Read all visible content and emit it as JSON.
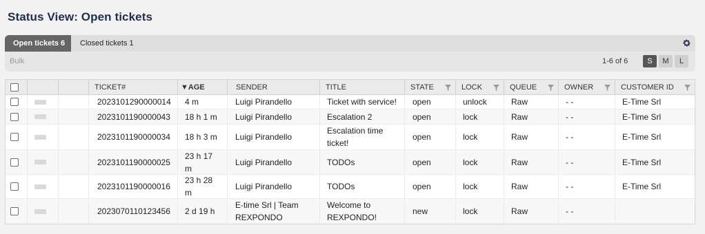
{
  "page": {
    "title": "Status View: Open tickets"
  },
  "tabs": [
    {
      "label": "Open tickets",
      "count": "6",
      "active": true
    },
    {
      "label": "Closed tickets",
      "count": "1",
      "active": false
    }
  ],
  "toolbar": {
    "bulk_label": "Bulk",
    "page_info": "1-6 of 6",
    "sizes": [
      "S",
      "M",
      "L"
    ],
    "active_size": "S",
    "settings_icon": "gear-icon"
  },
  "colors": {
    "active_tab": "#656565",
    "title": "#1f2d4f",
    "active_size": "#565656"
  },
  "table": {
    "columns": [
      "TICKET#",
      "AGE",
      "SENDER",
      "TITLE",
      "STATE",
      "LOCK",
      "QUEUE",
      "OWNER",
      "CUSTOMER ID"
    ],
    "sort_indicator": "▼",
    "sorted_column": "AGE",
    "rows": [
      {
        "ticket": "2023101290000014",
        "age": "4 m",
        "sender": "Luigi Pirandello",
        "title": "Ticket with service!",
        "state": "open",
        "lock": "unlock",
        "queue": "Raw",
        "owner": "- -",
        "customer": "E-Time Srl"
      },
      {
        "ticket": "2023101190000043",
        "age": "18 h 1 m",
        "sender": "Luigi Pirandello",
        "title": "Escalation 2",
        "state": "open",
        "lock": "lock",
        "queue": "Raw",
        "owner": "- -",
        "customer": "E-Time Srl"
      },
      {
        "ticket": "2023101190000034",
        "age": "18 h 3 m",
        "sender": "Luigi Pirandello",
        "title": "Escalation time ticket!",
        "state": "open",
        "lock": "lock",
        "queue": "Raw",
        "owner": "- -",
        "customer": "E-Time Srl"
      },
      {
        "ticket": "2023101190000025",
        "age": "23 h 17 m",
        "sender": "Luigi Pirandello",
        "title": "TODOs",
        "state": "open",
        "lock": "lock",
        "queue": "Raw",
        "owner": "- -",
        "customer": "E-Time Srl"
      },
      {
        "ticket": "2023101190000016",
        "age": "23 h 28 m",
        "sender": "Luigi Pirandello",
        "title": "TODOs",
        "state": "open",
        "lock": "lock",
        "queue": "Raw",
        "owner": "- -",
        "customer": "E-Time Srl"
      },
      {
        "ticket": "2023070110123456",
        "age": "2 d 19 h",
        "sender": "E-time Srl | Team REXPONDO",
        "title": "Welcome to REXPONDO!",
        "state": "new",
        "lock": "lock",
        "queue": "Raw",
        "owner": "- -",
        "customer": ""
      }
    ]
  }
}
